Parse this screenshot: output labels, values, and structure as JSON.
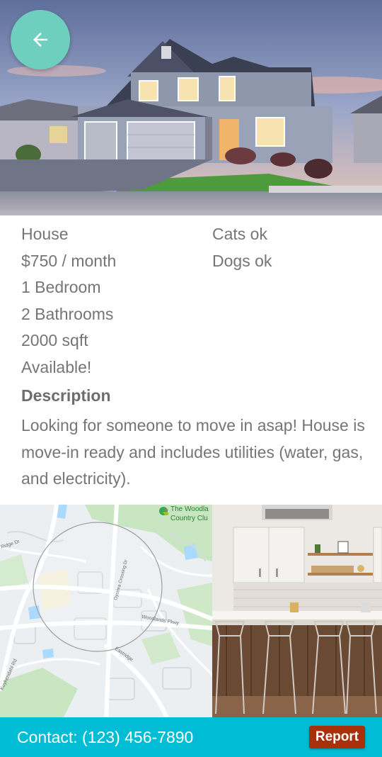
{
  "listing": {
    "type": "House",
    "price": "$750 / month",
    "bedrooms": "1 Bedroom",
    "bathrooms": "2 Bathrooms",
    "area": "2000 sqft",
    "availability": "Available!",
    "pets": [
      "Cats ok",
      "Dogs ok"
    ]
  },
  "description": {
    "title": "Description",
    "body": "Looking for someone to move in asap! House is move-in ready and includes utilities (water, gas, and electricity)."
  },
  "map": {
    "labels": {
      "poi": "The Woodla",
      "poi_line2": "Country Clu",
      "street_1": "Ridge Dr",
      "street_2": "Oystrea Crossing Dr",
      "street_3": "Woodlands Pkwy",
      "street_4": "Kuykendahl Rd",
      "street_5": "Eastridge"
    }
  },
  "footer": {
    "contact": "Contact: (123) 456-7890",
    "report_label": "Report"
  },
  "icons": {
    "back": "arrow-left-icon"
  },
  "colors": {
    "fab": "#6fcfbf",
    "footer": "#00bcd4",
    "report": "#a8300b",
    "text": "#757575"
  }
}
